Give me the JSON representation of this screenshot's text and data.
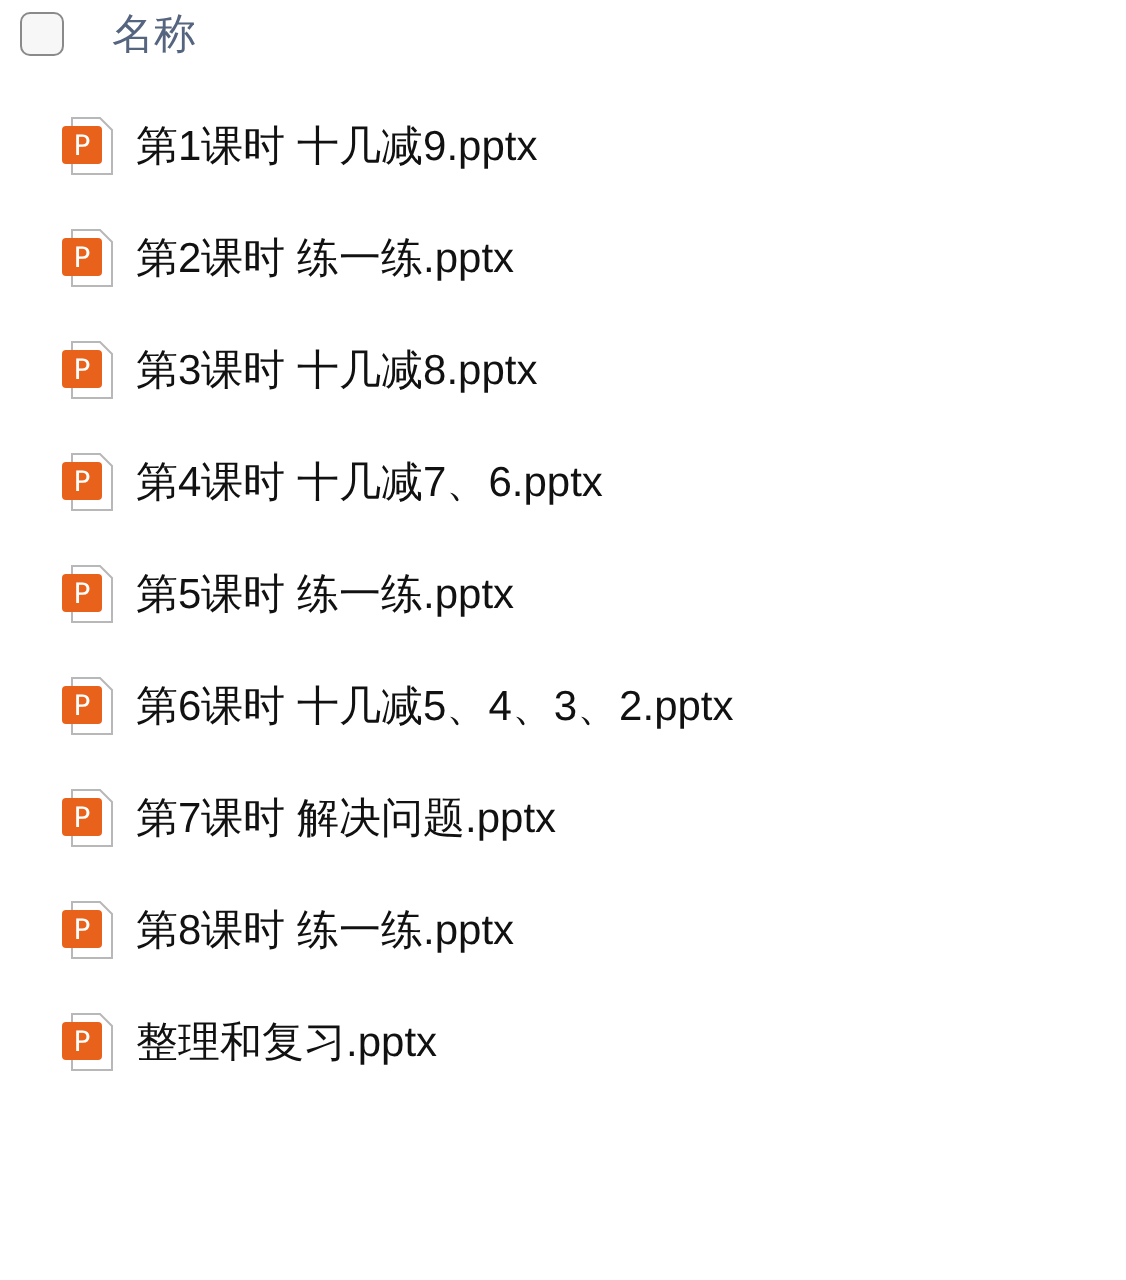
{
  "header": {
    "checked": false,
    "label": "名称"
  },
  "files": [
    {
      "name": "第1课时 十几减9.pptx",
      "icon_letter": "P"
    },
    {
      "name": "第2课时 练一练.pptx",
      "icon_letter": "P"
    },
    {
      "name": "第3课时 十几减8.pptx",
      "icon_letter": "P"
    },
    {
      "name": "第4课时 十几减7、6.pptx",
      "icon_letter": "P"
    },
    {
      "name": "第5课时 练一练.pptx",
      "icon_letter": "P"
    },
    {
      "name": "第6课时 十几减5、4、3、2.pptx",
      "icon_letter": "P"
    },
    {
      "name": "第7课时 解决问题.pptx",
      "icon_letter": "P"
    },
    {
      "name": "第8课时 练一练.pptx",
      "icon_letter": "P"
    },
    {
      "name": "整理和复习.pptx",
      "icon_letter": "P"
    }
  ]
}
